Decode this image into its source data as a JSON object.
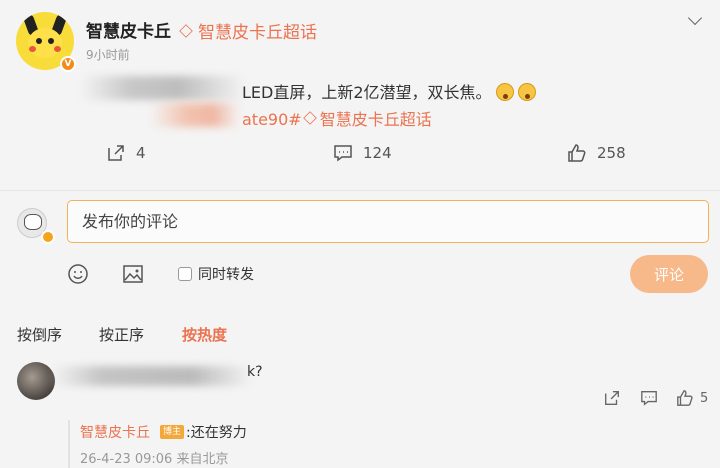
{
  "post": {
    "author": "智慧皮卡丘",
    "supertopic": "智慧皮卡丘超话",
    "timestamp": "9小时前",
    "line1": "LED直屏，上新2亿潜望，双长焦。",
    "line2": "ate90#",
    "line2_topic": "智慧皮卡丘超话",
    "repost_count": "4",
    "comment_count": "124",
    "like_count": "258"
  },
  "composer": {
    "placeholder": "发布你的评论",
    "repost_label": "同时转发",
    "submit_label": "评论"
  },
  "sort_tabs": [
    {
      "label": "按倒序"
    },
    {
      "label": "按正序"
    },
    {
      "label": "按热度"
    }
  ],
  "comment": {
    "text": "k?",
    "like_count": "5",
    "reply": {
      "author": "智慧皮卡丘",
      "op_tag": "博主",
      "text": ":还在努力",
      "meta": "26-4-23 09:06 来自北京"
    }
  },
  "colors": {
    "accent": "#eb7350",
    "input_border": "#f1b25a",
    "submit_bg": "#f7b88a"
  }
}
